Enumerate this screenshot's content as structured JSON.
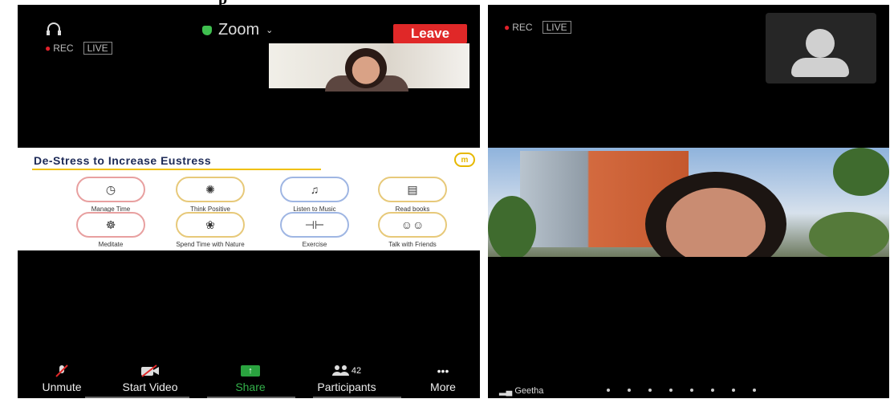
{
  "caption": "p",
  "left_screen": {
    "record": {
      "rec_label": "REC",
      "live_label": "LIVE"
    },
    "meeting_title": "Zoom",
    "leave_label": "Leave",
    "slide": {
      "title": "De-Stress to Increase Eustress",
      "logo_text": "m",
      "tips": [
        {
          "label": "Manage Time",
          "icon": "clock-icon",
          "glyph": "◷"
        },
        {
          "label": "Think Positive",
          "icon": "brain-icon",
          "glyph": "✺"
        },
        {
          "label": "Listen to Music",
          "icon": "music-note-icon",
          "glyph": "♫"
        },
        {
          "label": "Read books",
          "icon": "book-icon",
          "glyph": "▤"
        },
        {
          "label": "Meditate",
          "icon": "meditate-icon",
          "glyph": "☸"
        },
        {
          "label": "Spend Time with Nature",
          "icon": "nature-icon",
          "glyph": "❀"
        },
        {
          "label": "Exercise",
          "icon": "dumbbell-icon",
          "glyph": "⊣⊢"
        },
        {
          "label": "Talk with Friends",
          "icon": "friends-icon",
          "glyph": "☺☺"
        }
      ]
    },
    "toolbar": {
      "unmute": "Unmute",
      "start_video": "Start Video",
      "share": "Share",
      "participants": "Participants",
      "participants_count": "42",
      "more": "More"
    }
  },
  "right_screen": {
    "record": {
      "rec_label": "REC",
      "live_label": "LIVE"
    },
    "speaker_name": "Geetha"
  },
  "colors": {
    "leave": "#e02828",
    "share": "#2aa33f",
    "rec_dot": "#e0212a"
  }
}
